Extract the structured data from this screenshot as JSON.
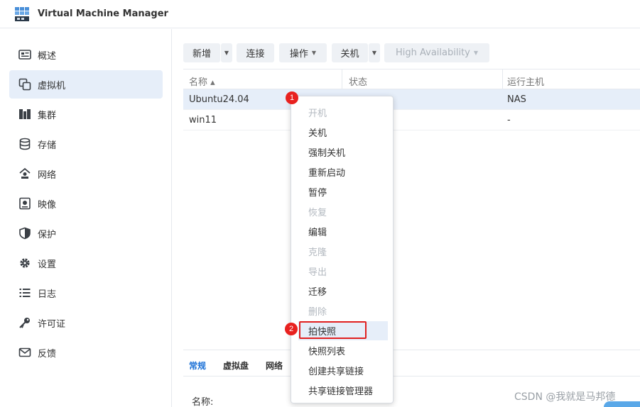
{
  "window": {
    "title": "Virtual Machine Manager"
  },
  "sidebar": {
    "items": [
      {
        "label": "概述",
        "icon": "overview-icon"
      },
      {
        "label": "虚拟机",
        "icon": "vm-icon"
      },
      {
        "label": "集群",
        "icon": "cluster-icon"
      },
      {
        "label": "存储",
        "icon": "storage-icon"
      },
      {
        "label": "网络",
        "icon": "network-icon"
      },
      {
        "label": "映像",
        "icon": "image-icon"
      },
      {
        "label": "保护",
        "icon": "shield-icon"
      },
      {
        "label": "设置",
        "icon": "gear-icon"
      },
      {
        "label": "日志",
        "icon": "log-icon"
      },
      {
        "label": "许可证",
        "icon": "key-icon"
      },
      {
        "label": "反馈",
        "icon": "mail-icon"
      }
    ],
    "active_index": 1
  },
  "toolbar": {
    "new_label": "新增",
    "connect_label": "连接",
    "action_label": "操作",
    "shutdown_label": "关机",
    "ha_label": "High Availability"
  },
  "table": {
    "columns": [
      "名称 ▴",
      "状态",
      "运行主机"
    ],
    "rows": [
      {
        "name": "Ubuntu24.04",
        "status": "",
        "host": "NAS"
      },
      {
        "name": "win11",
        "status": "",
        "host": "-"
      }
    ]
  },
  "context_menu": {
    "items": [
      {
        "label": "开机",
        "enabled": false
      },
      {
        "label": "关机",
        "enabled": true
      },
      {
        "label": "强制关机",
        "enabled": true
      },
      {
        "label": "重新启动",
        "enabled": true
      },
      {
        "label": "暂停",
        "enabled": true
      },
      {
        "label": "恢复",
        "enabled": false
      },
      {
        "label": "编辑",
        "enabled": true
      },
      {
        "label": "克隆",
        "enabled": false
      },
      {
        "label": "导出",
        "enabled": false
      },
      {
        "label": "迁移",
        "enabled": true
      },
      {
        "label": "删除",
        "enabled": false
      },
      {
        "label": "拍快照",
        "enabled": true
      },
      {
        "label": "快照列表",
        "enabled": true
      },
      {
        "label": "创建共享链接",
        "enabled": true
      },
      {
        "label": "共享链接管理器",
        "enabled": true
      }
    ]
  },
  "detail": {
    "tabs": [
      "常规",
      "虚拟盘",
      "网络"
    ],
    "name_label": "名称:"
  },
  "annotations": {
    "marker1": "1",
    "marker2": "2"
  },
  "watermark": "CSDN @我就是马邦德",
  "colors": {
    "accent": "#1a70d6",
    "selection": "#e6eef9",
    "highlight": "#e02020"
  }
}
